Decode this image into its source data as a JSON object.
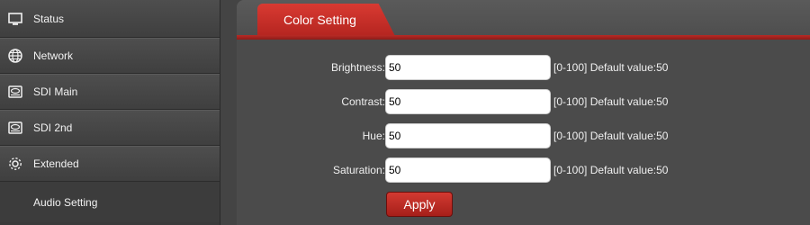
{
  "sidebar": {
    "items": [
      {
        "label": "Status",
        "icon": "monitor-icon"
      },
      {
        "label": "Network",
        "icon": "globe-icon"
      },
      {
        "label": "SDI Main",
        "icon": "hard-drive-icon"
      },
      {
        "label": "SDI 2nd",
        "icon": "hard-drive-icon"
      },
      {
        "label": "Extended",
        "icon": "gear-icon"
      }
    ],
    "sub_items": [
      {
        "label": "Audio Setting"
      }
    ]
  },
  "main": {
    "tab": {
      "label": "Color Setting"
    },
    "fields": [
      {
        "label": "Brightness:",
        "value": "50",
        "hint": "[0-100] Default value:50"
      },
      {
        "label": "Contrast:",
        "value": "50",
        "hint": "[0-100] Default value:50"
      },
      {
        "label": "Hue:",
        "value": "50",
        "hint": "[0-100] Default value:50"
      },
      {
        "label": "Saturation:",
        "value": "50",
        "hint": "[0-100] Default value:50"
      }
    ],
    "apply_label": "Apply"
  },
  "colors": {
    "accent_red": "#c0302a",
    "sidebar_bg": "#3a3a3a",
    "panel_bg": "#4b4b4b"
  }
}
